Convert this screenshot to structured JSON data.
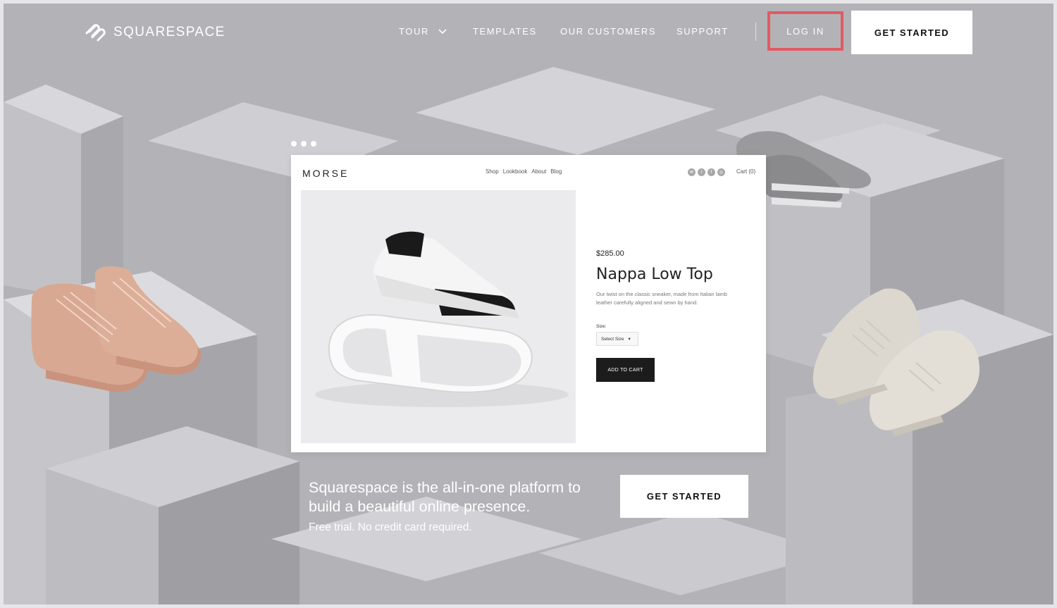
{
  "header": {
    "brand": "SQUARESPACE",
    "nav": [
      {
        "label": "TOUR",
        "has_dropdown": true
      },
      {
        "label": "TEMPLATES"
      },
      {
        "label": "OUR CUSTOMERS"
      },
      {
        "label": "SUPPORT"
      }
    ],
    "login_label": "LOG IN",
    "cta_label": "GET STARTED"
  },
  "preview": {
    "brand": "MORSE",
    "nav": [
      "Shop",
      "Lookbook",
      "About",
      "Blog"
    ],
    "social_icons": [
      "email-icon",
      "twitter-icon",
      "facebook-icon",
      "instagram-icon"
    ],
    "cart_label": "Cart (0)",
    "product": {
      "price": "$285.00",
      "title": "Nappa Low Top",
      "description": "Our twist on the classic sneaker, made from Italian lamb leather carefully aligned and sewn by hand.",
      "size_label": "Size:",
      "size_select": "Select Size",
      "add_to_cart": "ADD TO CART"
    }
  },
  "hero": {
    "tagline": "Squarespace is the all-in-one platform to build a beautiful online presence.",
    "subline": "Free trial. No credit card required.",
    "cta_label": "GET STARTED"
  },
  "colors": {
    "highlight": "#e15a63",
    "background": "#b9b9bd",
    "button_dark": "#1c1c1c"
  }
}
